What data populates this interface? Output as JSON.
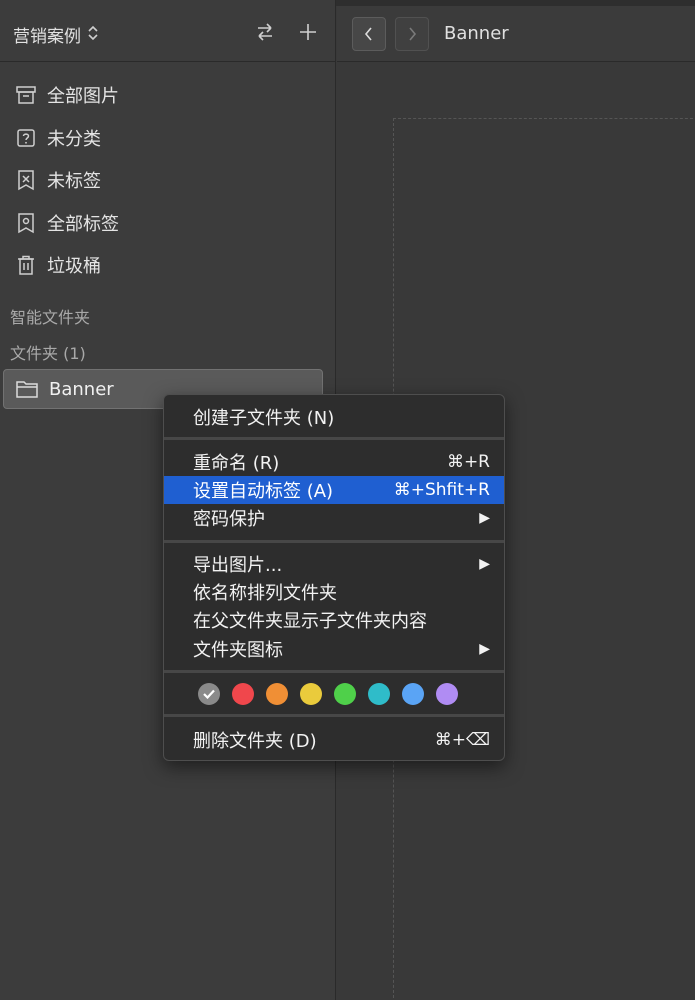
{
  "sidebar": {
    "library_title": "营销案例",
    "nav_items": [
      {
        "label": "全部图片",
        "icon": "archive-icon"
      },
      {
        "label": "未分类",
        "icon": "unknown-box-icon"
      },
      {
        "label": "未标签",
        "icon": "untagged-icon"
      },
      {
        "label": "全部标签",
        "icon": "tag-icon"
      },
      {
        "label": "垃圾桶",
        "icon": "trash-icon"
      }
    ],
    "smart_folders_label": "智能文件夹",
    "folders_label": "文件夹 (1)",
    "folder": {
      "label": "Banner",
      "icon": "folder-icon"
    }
  },
  "main": {
    "breadcrumb": "Banner"
  },
  "context_menu": {
    "items": {
      "create_subfolder": {
        "label": "创建子文件夹 (N)"
      },
      "rename": {
        "label": "重命名 (R)",
        "shortcut": "⌘+R"
      },
      "auto_tag": {
        "label": "设置自动标签 (A)",
        "shortcut": "⌘+Shfit+R"
      },
      "password": {
        "label": "密码保护"
      },
      "export": {
        "label": "导出图片..."
      },
      "sort_by_name": {
        "label": "依名称排列文件夹"
      },
      "show_sub_content": {
        "label": "在父文件夹显示子文件夹内容"
      },
      "folder_icon": {
        "label": "文件夹图标"
      },
      "delete": {
        "label": "删除文件夹 (D)",
        "shortcut": "⌘+⌫"
      }
    },
    "colors": [
      "#8a8a8a",
      "#f0474c",
      "#f08f35",
      "#eacb3c",
      "#4fd04a",
      "#2fbcc9",
      "#5aa4f5",
      "#b08cf3"
    ]
  }
}
